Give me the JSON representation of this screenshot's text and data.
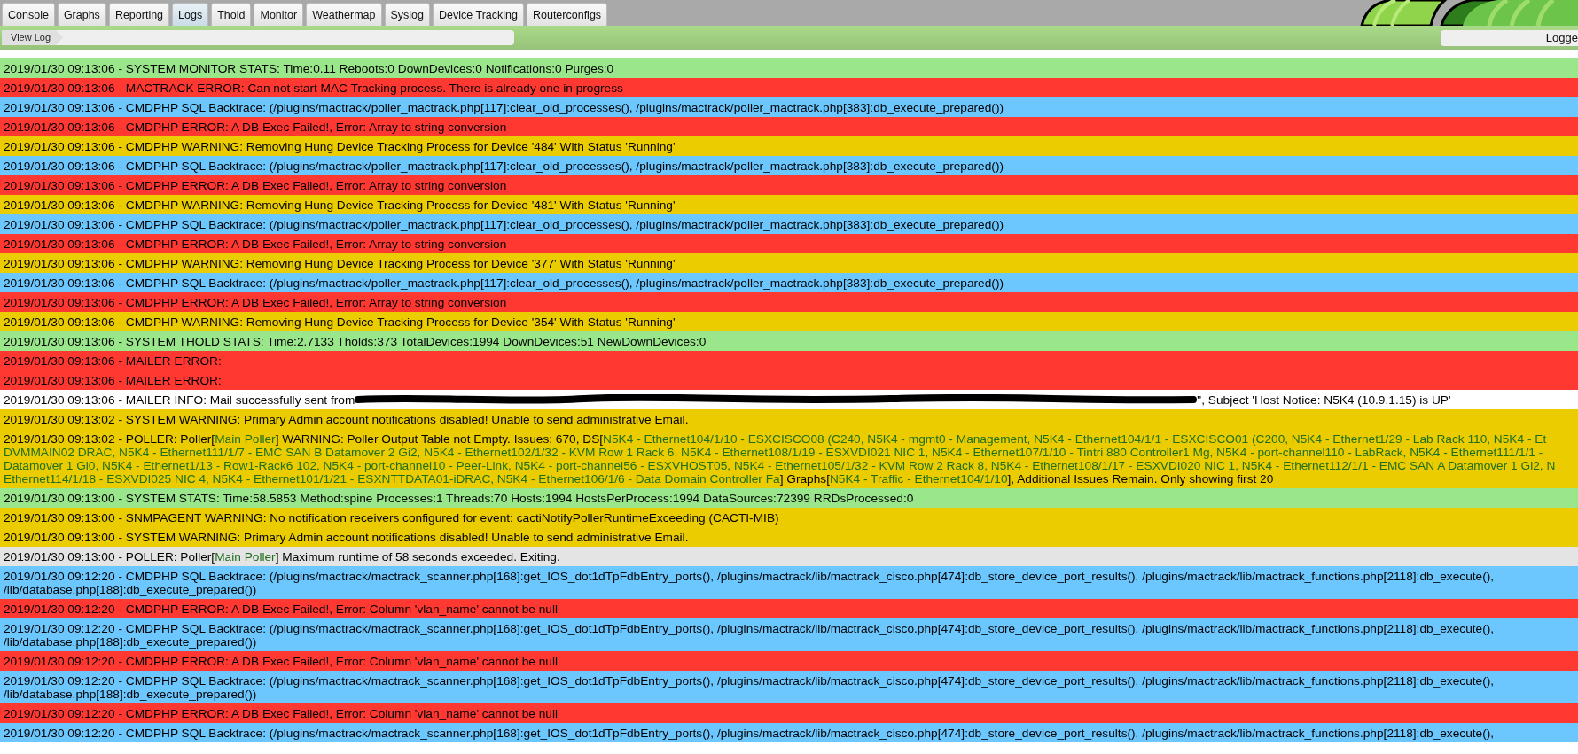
{
  "tabs": [
    {
      "label": "Console",
      "selected": false
    },
    {
      "label": "Graphs",
      "selected": false
    },
    {
      "label": "Reporting",
      "selected": false
    },
    {
      "label": "Logs",
      "selected": true
    },
    {
      "label": "Thold",
      "selected": false
    },
    {
      "label": "Monitor",
      "selected": false
    },
    {
      "label": "Weathermap",
      "selected": false
    },
    {
      "label": "Syslog",
      "selected": false
    },
    {
      "label": "Device Tracking",
      "selected": false
    },
    {
      "label": "Routerconfigs",
      "selected": false
    }
  ],
  "breadcrumb": "View Log",
  "user_box": "Logge",
  "log": [
    {
      "kind": "stats",
      "lines": [
        "2019/01/30 09:13:06 - SYSTEM MONITOR STATS: Time:0.11 Reboots:0 DownDevices:0 Notifications:0 Purges:0"
      ]
    },
    {
      "kind": "error",
      "lines": [
        "2019/01/30 09:13:06 - MACTRACK ERROR: Can not start MAC Tracking process. There is already one in progress"
      ]
    },
    {
      "kind": "debug",
      "lines": [
        "2019/01/30 09:13:06 - CMDPHP SQL Backtrace: (/plugins/mactrack/poller_mactrack.php[117]:clear_old_processes(), /plugins/mactrack/poller_mactrack.php[383]:db_execute_prepared())"
      ]
    },
    {
      "kind": "error",
      "lines": [
        "2019/01/30 09:13:06 - CMDPHP ERROR: A DB Exec Failed!, Error: Array to string conversion"
      ]
    },
    {
      "kind": "warning",
      "lines": [
        "2019/01/30 09:13:06 - CMDPHP WARNING: Removing Hung Device Tracking Process for Device '484' With Status 'Running'"
      ]
    },
    {
      "kind": "debug",
      "lines": [
        "2019/01/30 09:13:06 - CMDPHP SQL Backtrace: (/plugins/mactrack/poller_mactrack.php[117]:clear_old_processes(), /plugins/mactrack/poller_mactrack.php[383]:db_execute_prepared())"
      ]
    },
    {
      "kind": "error",
      "lines": [
        "2019/01/30 09:13:06 - CMDPHP ERROR: A DB Exec Failed!, Error: Array to string conversion"
      ]
    },
    {
      "kind": "warning",
      "lines": [
        "2019/01/30 09:13:06 - CMDPHP WARNING: Removing Hung Device Tracking Process for Device '481' With Status 'Running'"
      ]
    },
    {
      "kind": "debug",
      "lines": [
        "2019/01/30 09:13:06 - CMDPHP SQL Backtrace: (/plugins/mactrack/poller_mactrack.php[117]:clear_old_processes(), /plugins/mactrack/poller_mactrack.php[383]:db_execute_prepared())"
      ]
    },
    {
      "kind": "error",
      "lines": [
        "2019/01/30 09:13:06 - CMDPHP ERROR: A DB Exec Failed!, Error: Array to string conversion"
      ]
    },
    {
      "kind": "warning",
      "lines": [
        "2019/01/30 09:13:06 - CMDPHP WARNING: Removing Hung Device Tracking Process for Device '377' With Status 'Running'"
      ]
    },
    {
      "kind": "debug",
      "lines": [
        "2019/01/30 09:13:06 - CMDPHP SQL Backtrace: (/plugins/mactrack/poller_mactrack.php[117]:clear_old_processes(), /plugins/mactrack/poller_mactrack.php[383]:db_execute_prepared())"
      ]
    },
    {
      "kind": "error",
      "lines": [
        "2019/01/30 09:13:06 - CMDPHP ERROR: A DB Exec Failed!, Error: Array to string conversion"
      ]
    },
    {
      "kind": "warning",
      "lines": [
        "2019/01/30 09:13:06 - CMDPHP WARNING: Removing Hung Device Tracking Process for Device '354' With Status 'Running'"
      ]
    },
    {
      "kind": "stats",
      "lines": [
        "2019/01/30 09:13:06 - SYSTEM THOLD STATS: Time:2.7133 Tholds:373 TotalDevices:1994 DownDevices:51 NewDownDevices:0"
      ]
    },
    {
      "kind": "error",
      "lines": [
        "2019/01/30 09:13:06 - MAILER ERROR:"
      ]
    },
    {
      "kind": "error",
      "lines": [
        "2019/01/30 09:13:06 - MAILER ERROR:"
      ]
    },
    {
      "kind": "info",
      "lines": [
        [
          {
            "kind": "text",
            "text": "2019/01/30 09:13:06 - MAILER INFO: Mail successfully sent from"
          },
          {
            "kind": "redaction"
          },
          {
            "kind": "text",
            "text": "\", Subject 'Host Notice: N5K4 (10.9.1.15) is UP'"
          }
        ]
      ]
    },
    {
      "kind": "warning",
      "lines": [
        "2019/01/30 09:13:02 - SYSTEM WARNING: Primary Admin account notifications disabled! Unable to send administrative Email."
      ]
    },
    {
      "kind": "warning",
      "lines": [
        [
          {
            "kind": "text",
            "text": "2019/01/30 09:13:02 - POLLER: Poller["
          },
          {
            "kind": "link",
            "text": "Main Poller"
          },
          {
            "kind": "text",
            "text": "] WARNING: Poller Output Table not Empty. Issues: 670, DS["
          },
          {
            "kind": "link",
            "text": "N5K4 - Ethernet104/1/10 - ESXCISCO08 (C240, N5K4 - mgmt0 - Management, N5K4 - Ethernet104/1/1 - ESXCISCO01 (C200, N5K4 - Ethernet1/29 - Lab Rack 110, N5K4 - Et"
          }
        ],
        [
          {
            "kind": "link",
            "text": "DVMMAIN02 DRAC, N5K4 - Ethernet111/1/7 - EMC SAN B Datamover 2 Gi2, N5K4 - Ethernet102/1/32 - KVM Row 1 Rack 6, N5K4 - Ethernet108/1/19 - ESXVDI021 NIC 1, N5K4 - Ethernet107/1/10 - Tintri 880 Controller1 Mg, N5K4 - port-channel110 - LabRack, N5K4 - Ethernet111/1/1 -"
          }
        ],
        [
          {
            "kind": "link",
            "text": "Datamover 1 Gi0, N5K4 - Ethernet1/13 - Row1-Rack6 102, N5K4 - port-channel10 - Peer-Link, N5K4 - port-channel56 - ESXVHOST05, N5K4 - Ethernet105/1/32 - KVM Row 2 Rack 8, N5K4 - Ethernet108/1/17 - ESXVDI020 NIC 1, N5K4 - Ethernet112/1/1 - EMC SAN A Datamover 1 Gi2, N"
          }
        ],
        [
          {
            "kind": "link",
            "text": "Ethernet114/1/18 - ESXVDI025 NIC 4, N5K4 - Ethernet101/1/21 - ESXNTTDATA01-iDRAC, N5K4 - Ethernet106/1/6 - Data Domain Controller Fa"
          },
          {
            "kind": "text",
            "text": "] Graphs["
          },
          {
            "kind": "link",
            "text": "N5K4 - Traffic - Ethernet104/1/10"
          },
          {
            "kind": "text",
            "text": "], Additional Issues Remain. Only showing first 20"
          }
        ]
      ]
    },
    {
      "kind": "stats",
      "lines": [
        "2019/01/30 09:13:00 - SYSTEM STATS: Time:58.5853 Method:spine Processes:1 Threads:70 Hosts:1994 HostsPerProcess:1994 DataSources:72399 RRDsProcessed:0"
      ]
    },
    {
      "kind": "warning",
      "lines": [
        "2019/01/30 09:13:00 - SNMPAGENT WARNING: No notification receivers configured for event: cactiNotifyPollerRuntimeExceeding (CACTI-MIB)"
      ]
    },
    {
      "kind": "warning",
      "lines": [
        "2019/01/30 09:13:00 - SYSTEM WARNING: Primary Admin account notifications disabled! Unable to send administrative Email."
      ]
    },
    {
      "kind": "notice",
      "lines": [
        [
          {
            "kind": "text",
            "text": "2019/01/30 09:13:00 - POLLER: Poller["
          },
          {
            "kind": "link",
            "text": "Main Poller"
          },
          {
            "kind": "text",
            "text": "] Maximum runtime of 58 seconds exceeded. Exiting."
          }
        ]
      ]
    },
    {
      "kind": "debug",
      "lines": [
        "2019/01/30 09:12:20 - CMDPHP SQL Backtrace: (/plugins/mactrack/mactrack_scanner.php[168]:get_IOS_dot1dTpFdbEntry_ports(), /plugins/mactrack/lib/mactrack_cisco.php[474]:db_store_device_port_results(), /plugins/mactrack/lib/mactrack_functions.php[2118]:db_execute(),",
        "/lib/database.php[188]:db_execute_prepared())"
      ]
    },
    {
      "kind": "error",
      "lines": [
        "2019/01/30 09:12:20 - CMDPHP ERROR: A DB Exec Failed!, Error: Column 'vlan_name' cannot be null"
      ]
    },
    {
      "kind": "debug",
      "lines": [
        "2019/01/30 09:12:20 - CMDPHP SQL Backtrace: (/plugins/mactrack/mactrack_scanner.php[168]:get_IOS_dot1dTpFdbEntry_ports(), /plugins/mactrack/lib/mactrack_cisco.php[474]:db_store_device_port_results(), /plugins/mactrack/lib/mactrack_functions.php[2118]:db_execute(),",
        "/lib/database.php[188]:db_execute_prepared())"
      ]
    },
    {
      "kind": "error",
      "lines": [
        "2019/01/30 09:12:20 - CMDPHP ERROR: A DB Exec Failed!, Error: Column 'vlan_name' cannot be null"
      ]
    },
    {
      "kind": "debug",
      "lines": [
        "2019/01/30 09:12:20 - CMDPHP SQL Backtrace: (/plugins/mactrack/mactrack_scanner.php[168]:get_IOS_dot1dTpFdbEntry_ports(), /plugins/mactrack/lib/mactrack_cisco.php[474]:db_store_device_port_results(), /plugins/mactrack/lib/mactrack_functions.php[2118]:db_execute(),",
        "/lib/database.php[188]:db_execute_prepared())"
      ]
    },
    {
      "kind": "error",
      "lines": [
        "2019/01/30 09:12:20 - CMDPHP ERROR: A DB Exec Failed!, Error: Column 'vlan_name' cannot be null"
      ]
    },
    {
      "kind": "debug",
      "lines": [
        "2019/01/30 09:12:20 - CMDPHP SQL Backtrace: (/plugins/mactrack/mactrack_scanner.php[168]:get_IOS_dot1dTpFdbEntry_ports(), /plugins/mactrack/lib/mactrack_cisco.php[474]:db_store_device_port_results(), /plugins/mactrack/lib/mactrack_functions.php[2118]:db_execute(),"
      ]
    }
  ]
}
